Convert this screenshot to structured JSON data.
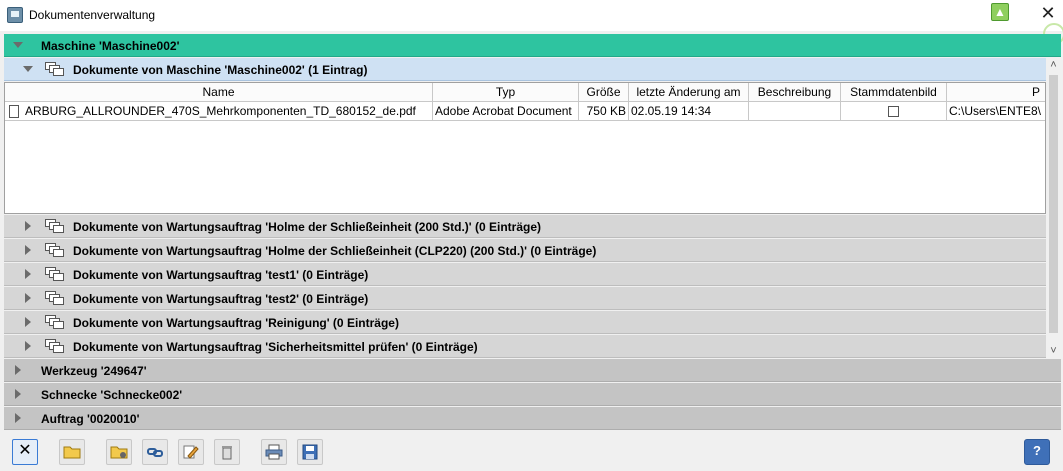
{
  "window": {
    "title": "Dokumentenverwaltung"
  },
  "tree": {
    "machine_label": "Maschine 'Maschine002'",
    "machine_docs_label": "Dokumente von Maschine 'Maschine002' (1 Eintrag)",
    "columns": [
      "Name",
      "Typ",
      "Größe",
      "letzte Änderung am",
      "Beschreibung",
      "Stammdatenbild",
      "P"
    ],
    "rows": [
      {
        "name": "ARBURG_ALLROUNDER_470S_Mehrkomponenten_TD_680152_de.pdf",
        "typ": "Adobe Acrobat Document",
        "groesse": "750 KB",
        "geaendert": "02.05.19 14:34",
        "beschreibung": "",
        "stammdatenbild": false,
        "pfad": "C:\\Users\\ENTE8\\"
      }
    ],
    "maintenance_groups": [
      "Dokumente von Wartungsauftrag 'Holme der Schließeinheit (200 Std.)' (0 Einträge)",
      "Dokumente von Wartungsauftrag 'Holme der Schließeinheit (CLP220) (200 Std.)' (0 Einträge)",
      "Dokumente von Wartungsauftrag 'test1' (0 Einträge)",
      "Dokumente von Wartungsauftrag 'test2' (0 Einträge)",
      "Dokumente von Wartungsauftrag 'Reinigung' (0 Einträge)",
      "Dokumente von Wartungsauftrag 'Sicherheitsmittel prüfen' (0 Einträge)"
    ],
    "top_groups": [
      "Werkzeug '249647'",
      "Schnecke 'Schnecke002'",
      "Auftrag '0020010'"
    ]
  },
  "toolbar": {
    "help_label": "?"
  },
  "colors": {
    "machine_row": "#2ec4a0",
    "docs_row": "#cfe1f3",
    "sub_row": "#d6d6d6"
  },
  "icons": {
    "close": "close-icon",
    "open": "folder-open-icon",
    "add": "folder-add-icon",
    "link": "link-icon",
    "edit": "edit-icon",
    "delete": "trash-icon",
    "print": "print-icon",
    "save": "save-icon",
    "help": "help-icon"
  }
}
